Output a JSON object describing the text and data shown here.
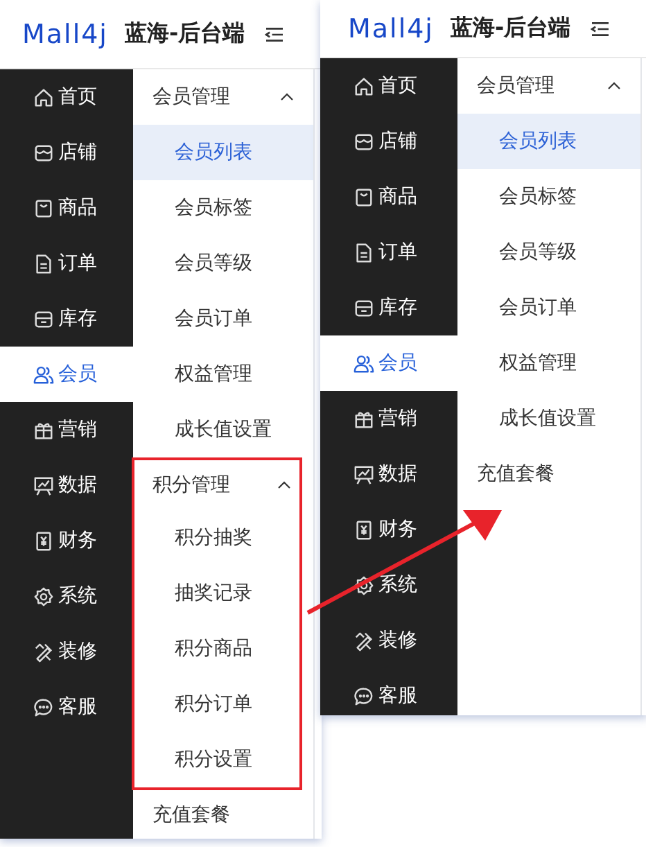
{
  "panels": [
    {
      "logo": "Mall4j",
      "title": "蓝海-后台端",
      "menu": [
        {
          "kind": "home",
          "label": "首页",
          "selected": false
        },
        {
          "kind": "shop",
          "label": "店铺",
          "selected": false
        },
        {
          "kind": "bag",
          "label": "商品",
          "selected": false
        },
        {
          "kind": "doc",
          "label": "订单",
          "selected": false
        },
        {
          "kind": "box",
          "label": "库存",
          "selected": false
        },
        {
          "kind": "users",
          "label": "会员",
          "selected": true
        },
        {
          "kind": "gift",
          "label": "营销",
          "selected": false
        },
        {
          "kind": "chart",
          "label": "数据",
          "selected": false
        },
        {
          "kind": "finance",
          "label": "财务",
          "selected": false
        },
        {
          "kind": "gear",
          "label": "系统",
          "selected": false
        },
        {
          "kind": "brush",
          "label": "装修",
          "selected": false
        },
        {
          "kind": "chat",
          "label": "客服",
          "selected": false
        }
      ],
      "submenu": [
        {
          "kind": "group",
          "label": "会员管理",
          "expanded": true,
          "highlighted": false,
          "children": [
            {
              "label": "会员列表",
              "selected": true
            },
            {
              "label": "会员标签",
              "selected": false
            },
            {
              "label": "会员等级",
              "selected": false
            },
            {
              "label": "会员订单",
              "selected": false
            },
            {
              "label": "权益管理",
              "selected": false
            },
            {
              "label": "成长值设置",
              "selected": false
            }
          ]
        },
        {
          "kind": "group",
          "label": "积分管理",
          "expanded": true,
          "highlighted": true,
          "children": [
            {
              "label": "积分抽奖",
              "selected": false
            },
            {
              "label": "抽奖记录",
              "selected": false
            },
            {
              "label": "积分商品",
              "selected": false
            },
            {
              "label": "积分订单",
              "selected": false
            },
            {
              "label": "积分设置",
              "selected": false
            }
          ]
        },
        {
          "kind": "item",
          "label": "充值套餐",
          "selected": false
        }
      ]
    },
    {
      "logo": "Mall4j",
      "title": "蓝海-后台端",
      "menu": [
        {
          "kind": "home",
          "label": "首页",
          "selected": false
        },
        {
          "kind": "shop",
          "label": "店铺",
          "selected": false
        },
        {
          "kind": "bag",
          "label": "商品",
          "selected": false
        },
        {
          "kind": "doc",
          "label": "订单",
          "selected": false
        },
        {
          "kind": "box",
          "label": "库存",
          "selected": false
        },
        {
          "kind": "users",
          "label": "会员",
          "selected": true
        },
        {
          "kind": "gift",
          "label": "营销",
          "selected": false
        },
        {
          "kind": "chart",
          "label": "数据",
          "selected": false
        },
        {
          "kind": "finance",
          "label": "财务",
          "selected": false
        },
        {
          "kind": "gear",
          "label": "系统",
          "selected": false
        },
        {
          "kind": "brush",
          "label": "装修",
          "selected": false
        },
        {
          "kind": "chat",
          "label": "客服",
          "selected": false
        }
      ],
      "submenu": [
        {
          "kind": "group",
          "label": "会员管理",
          "expanded": true,
          "highlighted": false,
          "children": [
            {
              "label": "会员列表",
              "selected": true
            },
            {
              "label": "会员标签",
              "selected": false
            },
            {
              "label": "会员等级",
              "selected": false
            },
            {
              "label": "会员订单",
              "selected": false
            },
            {
              "label": "权益管理",
              "selected": false
            },
            {
              "label": "成长值设置",
              "selected": false
            }
          ]
        },
        {
          "kind": "item",
          "label": "充值套餐",
          "selected": false
        }
      ]
    }
  ]
}
